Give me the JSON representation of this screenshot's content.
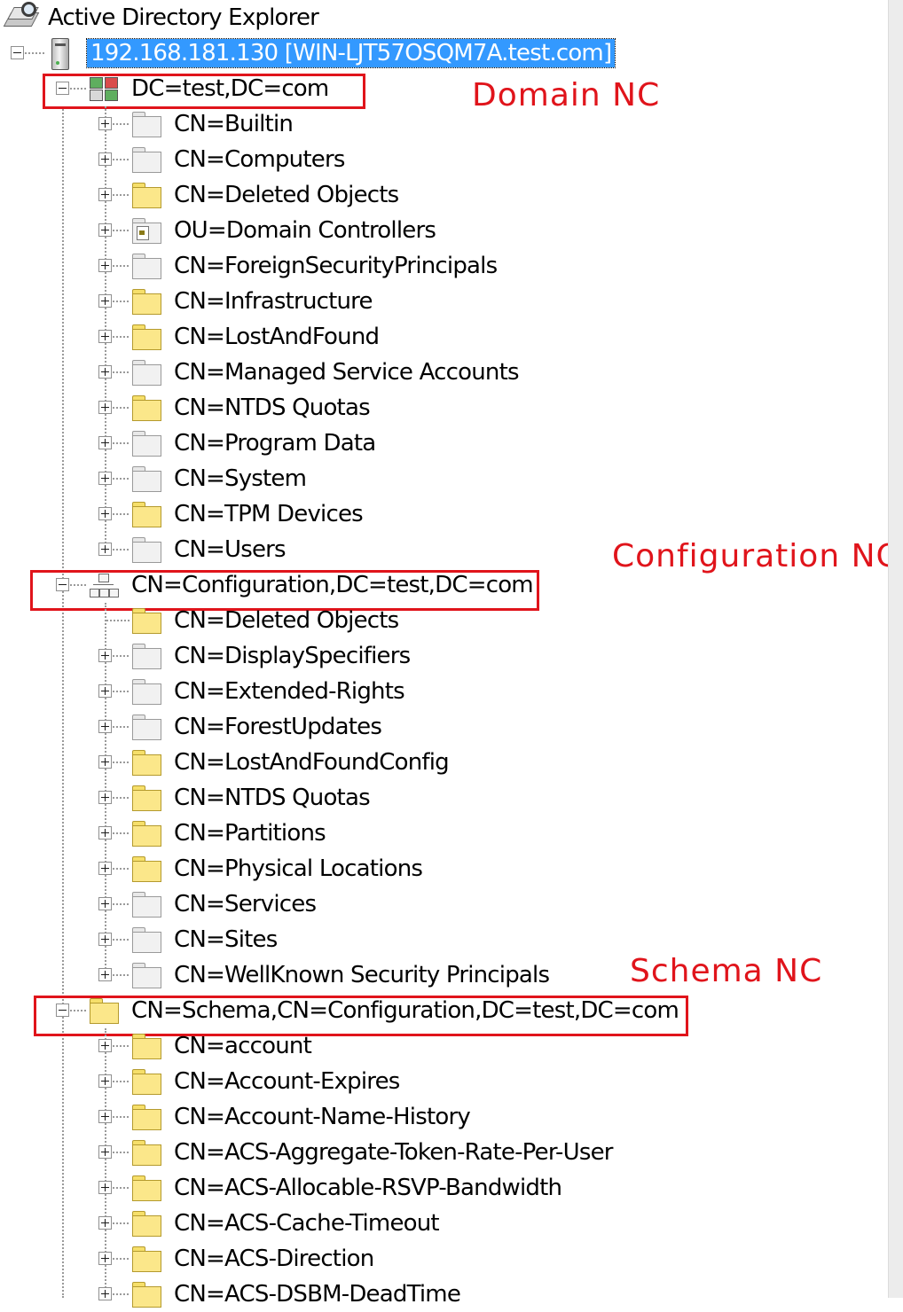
{
  "app": {
    "title": "Active Directory Explorer",
    "icon": "ad-explorer-icon"
  },
  "server": {
    "label": "192.168.181.130 [WIN-LJT57OSQM7A.test.com]",
    "icon": "server-icon",
    "expanded": true,
    "selected": true
  },
  "naming_contexts": [
    {
      "label": "DC=test,DC=com",
      "icon": "domain-icon",
      "annotation": "Domain NC",
      "children": [
        {
          "label": "CN=Builtin",
          "icon": "container-icon"
        },
        {
          "label": "CN=Computers",
          "icon": "container-icon"
        },
        {
          "label": "CN=Deleted Objects",
          "icon": "folder-icon"
        },
        {
          "label": "OU=Domain Controllers",
          "icon": "ou-icon"
        },
        {
          "label": "CN=ForeignSecurityPrincipals",
          "icon": "container-icon"
        },
        {
          "label": "CN=Infrastructure",
          "icon": "folder-icon"
        },
        {
          "label": "CN=LostAndFound",
          "icon": "folder-icon"
        },
        {
          "label": "CN=Managed Service Accounts",
          "icon": "container-icon"
        },
        {
          "label": "CN=NTDS Quotas",
          "icon": "folder-icon"
        },
        {
          "label": "CN=Program Data",
          "icon": "container-icon"
        },
        {
          "label": "CN=System",
          "icon": "container-icon"
        },
        {
          "label": "CN=TPM Devices",
          "icon": "folder-icon"
        },
        {
          "label": "CN=Users",
          "icon": "container-icon"
        }
      ]
    },
    {
      "label": "CN=Configuration,DC=test,DC=com",
      "icon": "configuration-icon",
      "annotation": "Configuration NC",
      "children": [
        {
          "label": "CN=Deleted Objects",
          "icon": "folder-icon",
          "leaf": true
        },
        {
          "label": "CN=DisplaySpecifiers",
          "icon": "container-icon"
        },
        {
          "label": "CN=Extended-Rights",
          "icon": "container-icon"
        },
        {
          "label": "CN=ForestUpdates",
          "icon": "container-icon"
        },
        {
          "label": "CN=LostAndFoundConfig",
          "icon": "folder-icon"
        },
        {
          "label": "CN=NTDS Quotas",
          "icon": "folder-icon"
        },
        {
          "label": "CN=Partitions",
          "icon": "folder-icon"
        },
        {
          "label": "CN=Physical Locations",
          "icon": "folder-icon"
        },
        {
          "label": "CN=Services",
          "icon": "container-icon"
        },
        {
          "label": "CN=Sites",
          "icon": "container-icon"
        },
        {
          "label": "CN=WellKnown Security Principals",
          "icon": "container-icon"
        }
      ]
    },
    {
      "label": "CN=Schema,CN=Configuration,DC=test,DC=com",
      "icon": "schema-icon",
      "annotation": "Schema NC",
      "children": [
        {
          "label": "CN=account",
          "icon": "folder-icon"
        },
        {
          "label": "CN=Account-Expires",
          "icon": "folder-icon"
        },
        {
          "label": "CN=Account-Name-History",
          "icon": "folder-icon"
        },
        {
          "label": "CN=ACS-Aggregate-Token-Rate-Per-User",
          "icon": "folder-icon"
        },
        {
          "label": "CN=ACS-Allocable-RSVP-Bandwidth",
          "icon": "folder-icon"
        },
        {
          "label": "CN=ACS-Cache-Timeout",
          "icon": "folder-icon"
        },
        {
          "label": "CN=ACS-Direction",
          "icon": "folder-icon"
        },
        {
          "label": "CN=ACS-DSBM-DeadTime",
          "icon": "folder-icon"
        }
      ]
    }
  ],
  "colors": {
    "annotation": "#e0141b",
    "selection": "#3399ff",
    "folder_yellow": "#fbe78a",
    "tree_line": "#9a9a9a"
  }
}
